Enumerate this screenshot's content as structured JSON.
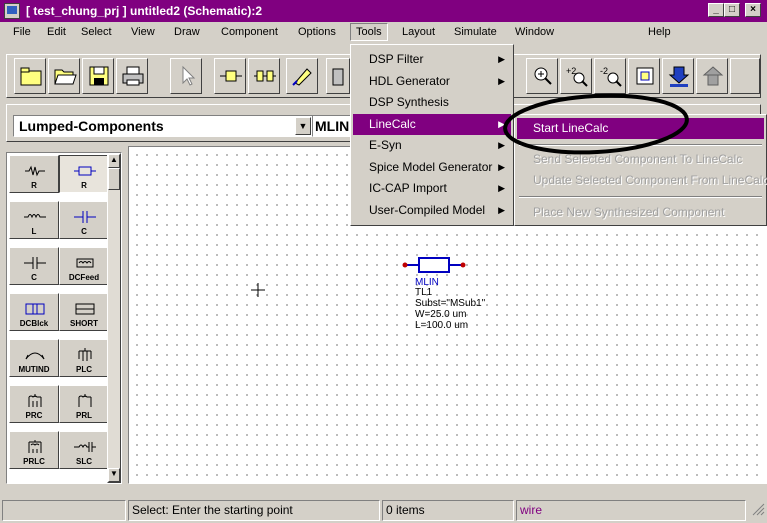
{
  "window": {
    "title": "[ test_chung_prj ] untitled2 (Schematic):2",
    "app_icon": "ads-app-icon",
    "controls": [
      "minimize",
      "maximize",
      "close"
    ]
  },
  "menubar": [
    {
      "label": "File"
    },
    {
      "label": "Edit"
    },
    {
      "label": "Select"
    },
    {
      "label": "View"
    },
    {
      "label": "Draw"
    },
    {
      "label": "Component"
    },
    {
      "label": "Options"
    },
    {
      "label": "Tools"
    },
    {
      "label": "Layout"
    },
    {
      "label": "Simulate"
    },
    {
      "label": "Window"
    },
    {
      "label": "Help"
    }
  ],
  "toolbar": {
    "buttons": [
      "new-folder-icon",
      "open-folder-icon",
      "save-icon",
      "print-icon",
      "select-arrow-icon",
      "insert-component-icon",
      "insert-port-icon",
      "edit-icon",
      "delete-icon",
      "zoom-icon",
      "zoom-in-icon",
      "zoom-out-icon",
      "push-into-hierarchy-icon",
      "simulate-icon",
      "tune-icon"
    ]
  },
  "library_select": {
    "value": "Lumped-Components"
  },
  "component_select": {
    "value": "MLIN"
  },
  "palette": {
    "items": [
      "R",
      "R",
      "L",
      "C",
      "C",
      "DCFeed",
      "DCBlck",
      "SHORT",
      "MUTIND",
      "PLC",
      "PRC",
      "PRL",
      "PRLC",
      "SLC"
    ]
  },
  "tools_menu": {
    "items": [
      {
        "label": "DSP Filter",
        "submenu": true
      },
      {
        "label": "HDL Generator",
        "submenu": true
      },
      {
        "label": "DSP Synthesis",
        "submenu": false
      },
      {
        "label": "LineCalc",
        "submenu": true,
        "highlighted": true
      },
      {
        "label": "E-Syn",
        "submenu": true
      },
      {
        "label": "Spice Model Generator",
        "submenu": true
      },
      {
        "label": "IC-CAP Import",
        "submenu": true
      },
      {
        "label": "User-Compiled Model",
        "submenu": true
      }
    ]
  },
  "linecalc_submenu": {
    "items": [
      {
        "label": "Start LineCalc",
        "highlighted": true,
        "enabled": true
      },
      {
        "label": "Send Selected Component To LineCalc",
        "enabled": false
      },
      {
        "label": "Update Selected Component From LineCalc",
        "enabled": false
      },
      {
        "label": "Place New Synthesized Component",
        "enabled": false
      }
    ]
  },
  "schematic": {
    "component": {
      "type": "MLIN",
      "name": "TL1",
      "params": [
        "Subst=\"MSub1\"",
        "W=25.0 um",
        "L=100.0 um"
      ]
    }
  },
  "status": {
    "message": "Select: Enter the starting point",
    "items": "0 items",
    "mode": "wire"
  },
  "colors": {
    "title_bar": "#800080",
    "highlight": "#800080",
    "component": "#0000c0",
    "pin": "#c00000",
    "mode_text": "#800080"
  }
}
